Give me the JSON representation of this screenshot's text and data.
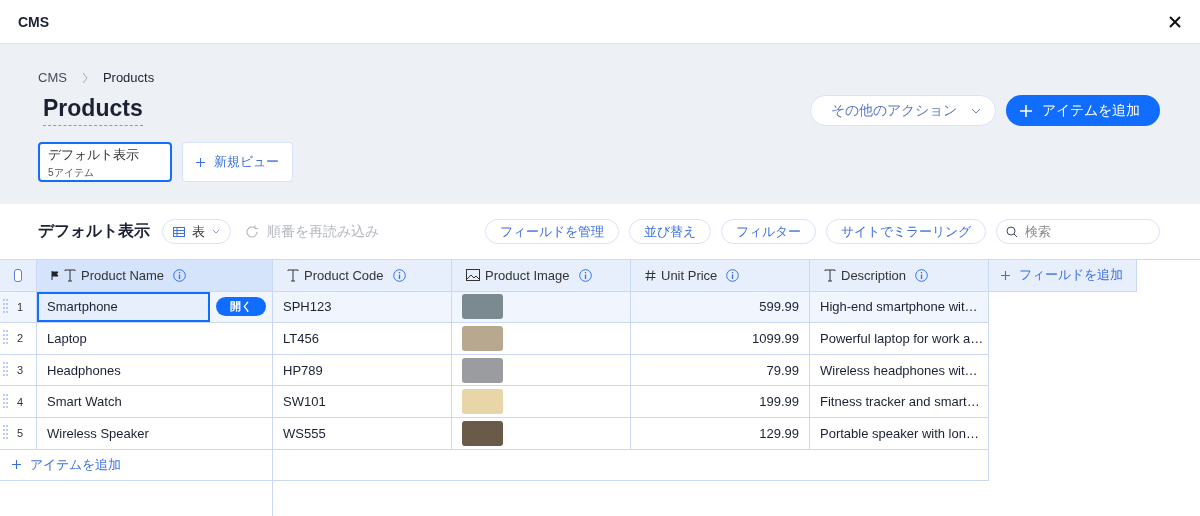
{
  "window": {
    "title": "CMS"
  },
  "breadcrumb": [
    "CMS",
    "Products"
  ],
  "page_title": "Products",
  "header_actions": {
    "more": "その他のアクション",
    "add": "アイテムを追加"
  },
  "views": [
    {
      "label": "デフォルト表示",
      "count": "5アイテム",
      "selected": true
    }
  ],
  "new_view": "新規ビュー",
  "toolbar": {
    "title": "デフォルト表示",
    "layout": "表",
    "reload": "順番を再読み込み",
    "buttons": [
      "フィールドを管理",
      "並び替え",
      "フィルター",
      "サイトでミラーリング"
    ],
    "search_placeholder": "検索"
  },
  "table": {
    "select_all_checked": false,
    "columns": [
      {
        "label": "Product Name",
        "kind": "text",
        "primary": true
      },
      {
        "label": "Product Code",
        "kind": "text",
        "primary": false
      },
      {
        "label": "Product Image",
        "kind": "image",
        "primary": false
      },
      {
        "label": "Unit Price",
        "kind": "number",
        "primary": false
      },
      {
        "label": "Description",
        "kind": "text",
        "primary": false
      }
    ],
    "add_field": "フィールドを追加",
    "open_label": "開く",
    "rows": [
      {
        "num": "1",
        "selected": true,
        "cells": [
          "Smartphone",
          "SPH123",
          "",
          "599.99",
          "High-end smartphone wit…"
        ]
      },
      {
        "num": "2",
        "selected": false,
        "cells": [
          "Laptop",
          "LT456",
          "",
          "1099.99",
          "Powerful laptop for work a…"
        ]
      },
      {
        "num": "3",
        "selected": false,
        "cells": [
          "Headphones",
          "HP789",
          "",
          "79.99",
          "Wireless headphones wit…"
        ]
      },
      {
        "num": "4",
        "selected": false,
        "cells": [
          "Smart Watch",
          "SW101",
          "",
          "199.99",
          "Fitness tracker and smart…"
        ]
      },
      {
        "num": "5",
        "selected": false,
        "cells": [
          "Wireless Speaker",
          "WS555",
          "",
          "129.99",
          "Portable speaker with lon…"
        ]
      }
    ],
    "add_item": "アイテムを追加"
  }
}
